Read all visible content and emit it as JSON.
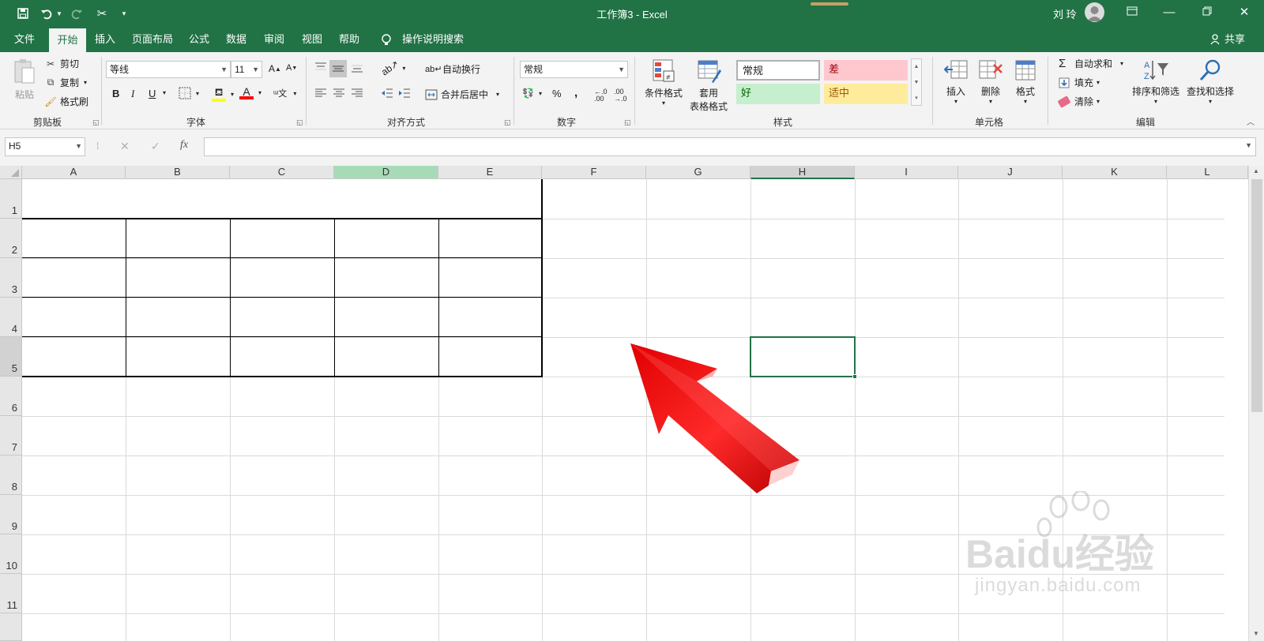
{
  "window": {
    "title": "工作簿3 - Excel",
    "user": "刘 玲"
  },
  "qat": {
    "save_icon": "save-icon",
    "undo_icon": "undo-icon",
    "redo_icon": "redo-icon",
    "cut_icon": "scissors-icon",
    "customize_icon": "chevron-down-icon"
  },
  "tabs": [
    "文件",
    "开始",
    "插入",
    "页面布局",
    "公式",
    "数据",
    "审阅",
    "视图",
    "帮助"
  ],
  "active_tab": "开始",
  "tell_me": "操作说明搜索",
  "share": "共享",
  "ribbon": {
    "clipboard": {
      "paste": "粘贴",
      "cut": "剪切",
      "copy": "复制",
      "format_painter": "格式刷",
      "label": "剪贴板"
    },
    "font": {
      "name": "等线",
      "size": "11",
      "bold": "B",
      "italic": "I",
      "underline": "U",
      "font_color_accent": "#ff0000",
      "highlight_accent": "#ffff00",
      "label": "字体"
    },
    "alignment": {
      "wrap": "自动换行",
      "merge": "合并后居中",
      "label": "对齐方式"
    },
    "number": {
      "format": "常规",
      "percent": "%",
      "comma": ",",
      "label": "数字"
    },
    "styles": {
      "conditional": "条件格式",
      "table_1": "套用",
      "table_2": "表格格式",
      "normal": "常规",
      "bad": "差",
      "good": "好",
      "neutral": "适中",
      "label": "样式"
    },
    "cells": {
      "insert": "插入",
      "delete": "删除",
      "format": "格式",
      "label": "单元格"
    },
    "editing": {
      "autosum": "自动求和",
      "fill": "填充",
      "clear": "清除",
      "sort": "排序和筛选",
      "find": "查找和选择",
      "label": "编辑"
    }
  },
  "formula": {
    "name_box": "H5",
    "fx": "fx",
    "value": ""
  },
  "sheet": {
    "columns": [
      "A",
      "B",
      "C",
      "D",
      "E",
      "F",
      "G",
      "H",
      "I",
      "J",
      "K",
      "L"
    ],
    "rows": [
      "1",
      "2",
      "3",
      "4",
      "5",
      "6",
      "7",
      "8",
      "9",
      "10",
      "11"
    ],
    "selected_cell": "H5"
  },
  "watermark": {
    "logo": "Baidu经验",
    "url": "jingyan.baidu.com"
  },
  "colors": {
    "excel_green": "#217346",
    "bad_bg": "#ffc7ce",
    "good_bg": "#c6efce",
    "neutral_bg": "#ffeb9c"
  }
}
